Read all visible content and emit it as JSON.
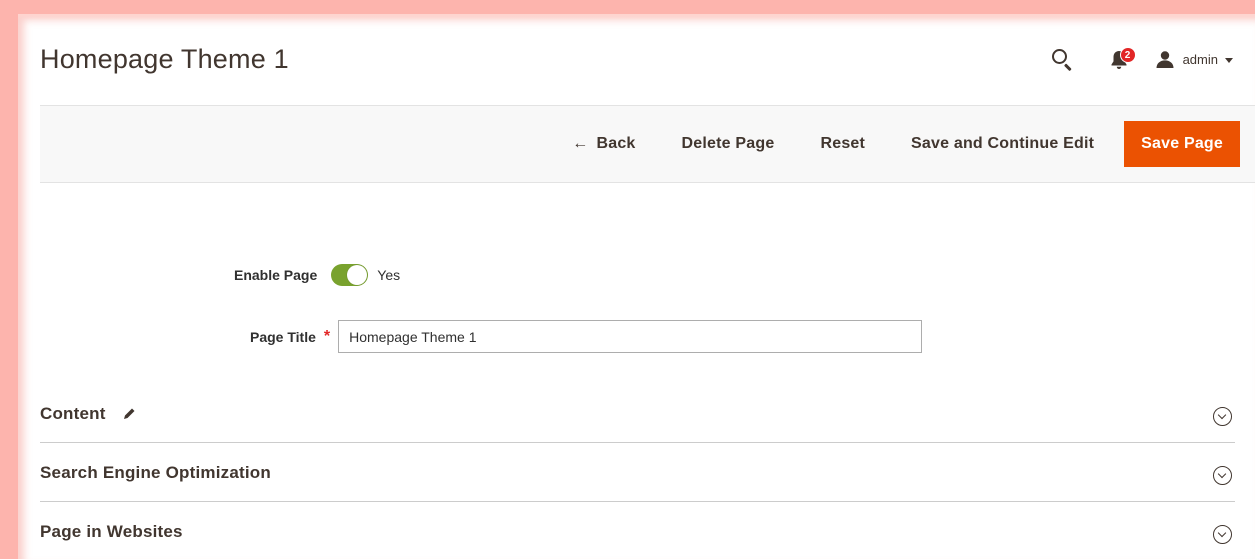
{
  "page": {
    "title": "Homepage Theme 1"
  },
  "header": {
    "notification_count": "2",
    "user_name": "admin"
  },
  "toolbar": {
    "back_arrow": "←",
    "back_label": "Back",
    "delete_label": "Delete Page",
    "reset_label": "Reset",
    "save_continue_label": "Save and Continue Edit",
    "save_label": "Save Page"
  },
  "form": {
    "enable_page_label": "Enable Page",
    "enable_page_value": "Yes",
    "page_title_label": "Page Title",
    "required_mark": "*",
    "page_title_value": "Homepage Theme 1"
  },
  "sections": [
    {
      "title": "Content"
    },
    {
      "title": "Search Engine Optimization"
    },
    {
      "title": "Page in Websites"
    }
  ],
  "colors": {
    "accent": "#eb5202",
    "toggle_on": "#79a22e",
    "badge": "#e22626",
    "text_dark": "#41362f"
  },
  "icons": [
    "search-icon",
    "bell-icon",
    "user-icon",
    "caret-down-icon",
    "arrow-left-icon",
    "pencil-icon",
    "chevron-down-icon"
  ]
}
